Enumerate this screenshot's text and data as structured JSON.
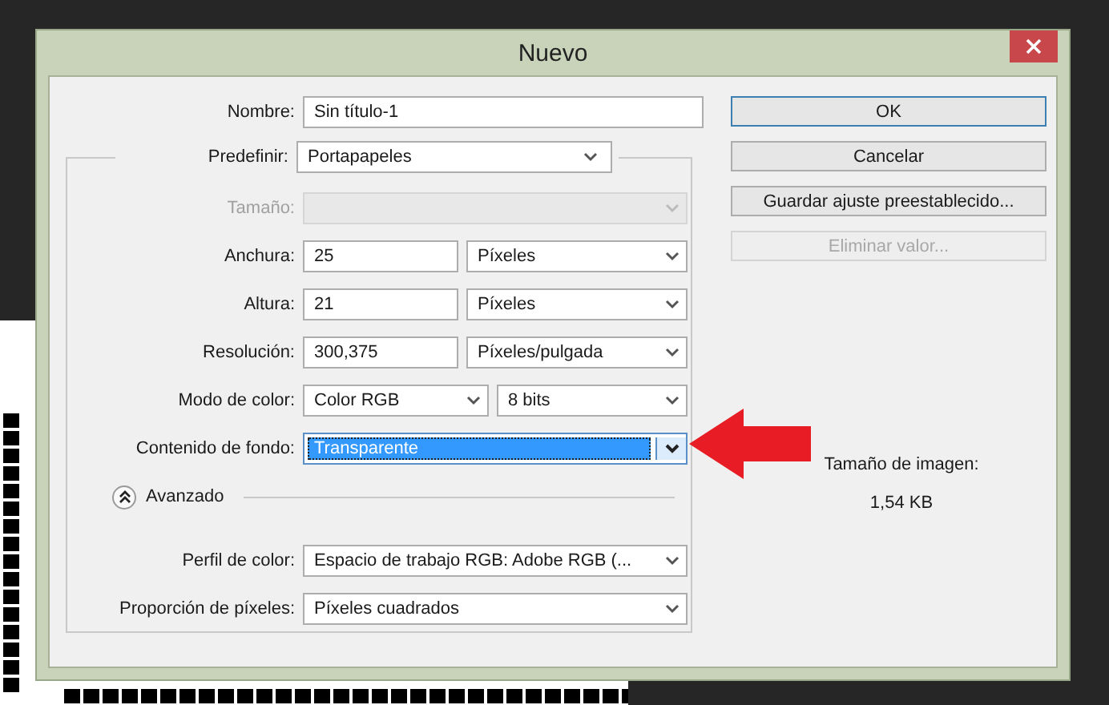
{
  "window": {
    "title": "Nuevo"
  },
  "name": {
    "label": "Nombre:",
    "value": "Sin título-1"
  },
  "preset": {
    "label": "Predefinir:",
    "value": "Portapapeles"
  },
  "rows": [
    {
      "label": "Tamaño:",
      "disabled": true,
      "controls": [
        {
          "kind": "select",
          "wide": true
        }
      ]
    },
    {
      "label": "Anchura:",
      "disabled": false,
      "controls": [
        {
          "kind": "input",
          "value": "25"
        },
        {
          "kind": "select",
          "value": "Píxeles"
        }
      ]
    },
    {
      "label": "Altura:",
      "disabled": false,
      "controls": [
        {
          "kind": "input",
          "value": "21"
        },
        {
          "kind": "select",
          "value": "Píxeles"
        }
      ]
    },
    {
      "label": "Resolución:",
      "disabled": false,
      "controls": [
        {
          "kind": "input",
          "value": "300,375"
        },
        {
          "kind": "select",
          "value": "Píxeles/pulgada"
        }
      ]
    },
    {
      "label": "Modo de color:",
      "disabled": false,
      "controls": [
        {
          "kind": "select",
          "value": "Color RGB"
        },
        {
          "kind": "select",
          "value": "8 bits"
        }
      ]
    },
    {
      "label": "Contenido de fondo:",
      "disabled": false,
      "controls": [
        {
          "kind": "select",
          "value": "Transparente",
          "wide": true,
          "focused": true
        }
      ]
    }
  ],
  "advanced": {
    "label": "Avanzado",
    "expanded": true
  },
  "advanced_rows": [
    {
      "label": "Perfil de color:",
      "disabled": false,
      "controls": [
        {
          "kind": "select",
          "value": "Espacio de trabajo RGB: Adobe RGB (...",
          "wide": true
        }
      ]
    },
    {
      "label": "Proporción de píxeles:",
      "disabled": false,
      "controls": [
        {
          "kind": "select",
          "value": "Píxeles cuadrados",
          "wide": true
        }
      ]
    }
  ],
  "buttons": [
    {
      "label": "OK",
      "default": true,
      "disabled": false
    },
    {
      "label": "Cancelar",
      "default": false,
      "disabled": false
    },
    {
      "label": "Guardar ajuste preestablecido...",
      "default": false,
      "disabled": false
    },
    {
      "label": "Eliminar valor...",
      "default": false,
      "disabled": true
    }
  ],
  "image_size": {
    "label": "Tamaño de imagen:",
    "value": "1,54 KB"
  }
}
